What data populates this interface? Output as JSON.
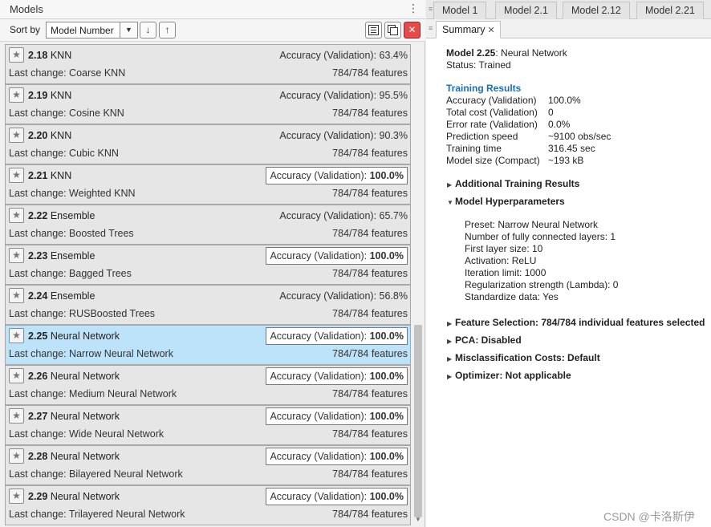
{
  "left_panel": {
    "title": "Models",
    "menu_glyph": "⋮",
    "sort_label": "Sort by",
    "sort_value": "Model Number",
    "sort_desc_glyph": "↓",
    "sort_asc_glyph": "↑",
    "close_glyph": "✕",
    "models": [
      {
        "number": "2.18",
        "type": "KNN",
        "change": "Last change: Coarse KNN",
        "accuracy": "Accuracy (Validation): 63.4%",
        "acc_label": "",
        "acc_value": "",
        "best": false,
        "features": "784/784 features",
        "selected": false
      },
      {
        "number": "2.19",
        "type": "KNN",
        "change": "Last change: Cosine KNN",
        "accuracy": "Accuracy (Validation): 95.5%",
        "acc_label": "",
        "acc_value": "",
        "best": false,
        "features": "784/784 features",
        "selected": false
      },
      {
        "number": "2.20",
        "type": "KNN",
        "change": "Last change: Cubic KNN",
        "accuracy": "Accuracy (Validation): 90.3%",
        "acc_label": "",
        "acc_value": "",
        "best": false,
        "features": "784/784 features",
        "selected": false
      },
      {
        "number": "2.21",
        "type": "KNN",
        "change": "Last change: Weighted KNN",
        "accuracy": "",
        "acc_label": "Accuracy (Validation): ",
        "acc_value": "100.0%",
        "best": true,
        "features": "784/784 features",
        "selected": false
      },
      {
        "number": "2.22",
        "type": "Ensemble",
        "change": "Last change: Boosted Trees",
        "accuracy": "Accuracy (Validation): 65.7%",
        "acc_label": "",
        "acc_value": "",
        "best": false,
        "features": "784/784 features",
        "selected": false
      },
      {
        "number": "2.23",
        "type": "Ensemble",
        "change": "Last change: Bagged Trees",
        "accuracy": "",
        "acc_label": "Accuracy (Validation): ",
        "acc_value": "100.0%",
        "best": true,
        "features": "784/784 features",
        "selected": false
      },
      {
        "number": "2.24",
        "type": "Ensemble",
        "change": "Last change: RUSBoosted Trees",
        "accuracy": "Accuracy (Validation): 56.8%",
        "acc_label": "",
        "acc_value": "",
        "best": false,
        "features": "784/784 features",
        "selected": false
      },
      {
        "number": "2.25",
        "type": "Neural Network",
        "change": "Last change: Narrow Neural Network",
        "accuracy": "",
        "acc_label": "Accuracy (Validation): ",
        "acc_value": "100.0%",
        "best": true,
        "features": "784/784 features",
        "selected": true
      },
      {
        "number": "2.26",
        "type": "Neural Network",
        "change": "Last change: Medium Neural Network",
        "accuracy": "",
        "acc_label": "Accuracy (Validation): ",
        "acc_value": "100.0%",
        "best": true,
        "features": "784/784 features",
        "selected": false
      },
      {
        "number": "2.27",
        "type": "Neural Network",
        "change": "Last change: Wide Neural Network",
        "accuracy": "",
        "acc_label": "Accuracy (Validation): ",
        "acc_value": "100.0%",
        "best": true,
        "features": "784/784 features",
        "selected": false
      },
      {
        "number": "2.28",
        "type": "Neural Network",
        "change": "Last change: Bilayered Neural Network",
        "accuracy": "",
        "acc_label": "Accuracy (Validation): ",
        "acc_value": "100.0%",
        "best": true,
        "features": "784/784 features",
        "selected": false
      },
      {
        "number": "2.29",
        "type": "Neural Network",
        "change": "Last change: Trilayered Neural Network",
        "accuracy": "",
        "acc_label": "Accuracy (Validation): ",
        "acc_value": "100.0%",
        "best": true,
        "features": "784/784 features",
        "selected": false
      }
    ]
  },
  "right_panel": {
    "top_tabs": [
      "Model 1",
      "Model 2.1",
      "Model 2.12",
      "Model 2.21"
    ],
    "summary_tab": "Summary",
    "summary_close": "✕",
    "model_label": "Model 2.25",
    "model_type": ": Neural Network",
    "status": "Status: Trained",
    "training_title": "Training Results",
    "results": [
      {
        "key": "Accuracy (Validation)",
        "value": "100.0%"
      },
      {
        "key": "Total cost (Validation)",
        "value": "0"
      },
      {
        "key": "Error rate (Validation)",
        "value": "0.0%"
      },
      {
        "key": "Prediction speed",
        "value": "~9100 obs/sec"
      },
      {
        "key": "Training time",
        "value": "316.45 sec"
      },
      {
        "key": "Model size (Compact)",
        "value": "~193 kB"
      }
    ],
    "additional_results": "Additional Training Results",
    "hyperparameters_title": "Model Hyperparameters",
    "hyperparameters": [
      "Preset: Narrow Neural Network",
      "Number of fully connected layers: 1",
      "First layer size: 10",
      "Activation: ReLU",
      "Iteration limit: 1000",
      "Regularization strength (Lambda): 0",
      "Standardize data: Yes"
    ],
    "feature_selection": "Feature Selection: 784/784 individual features selected",
    "pca": "PCA: Disabled",
    "misclassification": "Misclassification Costs: Default",
    "optimizer": "Optimizer: Not applicable"
  },
  "watermark": "CSDN @卡洛斯伊"
}
